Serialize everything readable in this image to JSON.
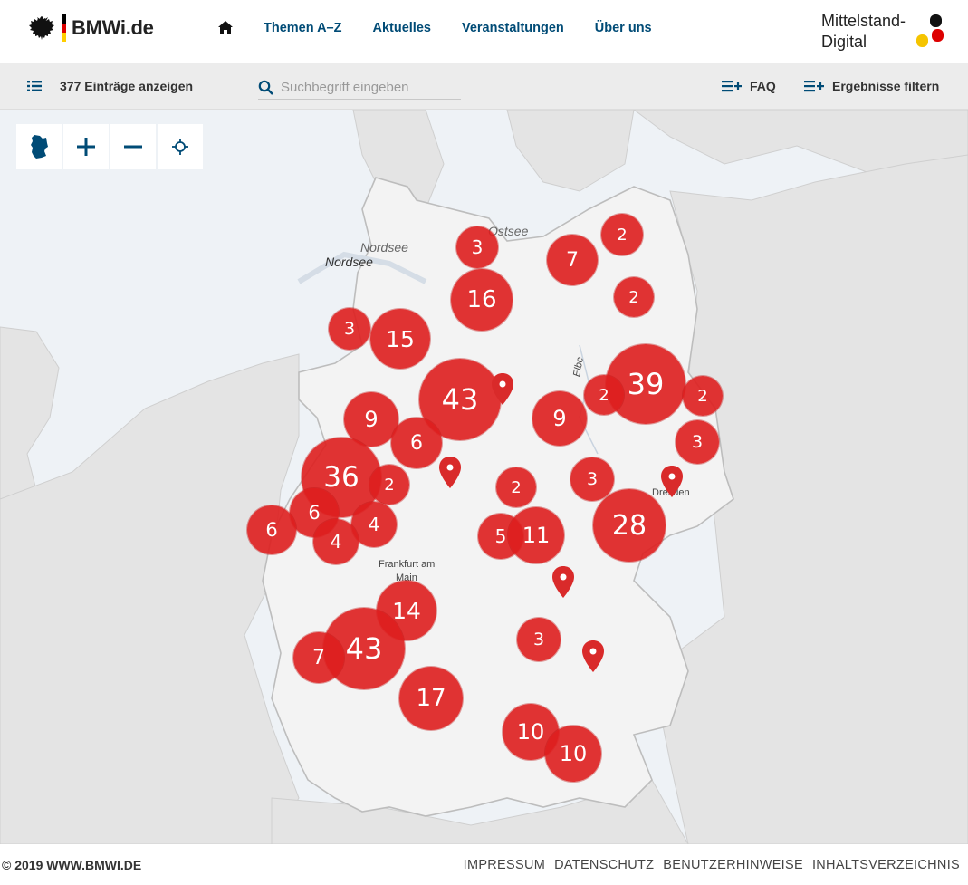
{
  "header": {
    "logo_text": "BMWi.de",
    "nav": [
      "Themen A–Z",
      "Aktuelles",
      "Veranstaltungen",
      "Über uns"
    ],
    "partner_line1": "Mittelstand-",
    "partner_line2": "Digital"
  },
  "toolbar": {
    "entries_label": "377 Einträge anzeigen",
    "search_placeholder": "Suchbegriff eingeben",
    "faq_label": "FAQ",
    "filter_label": "Ergebnisse filtern"
  },
  "map": {
    "labels": {
      "ostsee": "Ostsee",
      "nordsee1": "Nordsee",
      "nordsee2": "Nordsee",
      "frankfurt": "Frankfurt am",
      "main": "Main",
      "dresden": "Dresden",
      "elbe": "Elbe"
    },
    "clusters": [
      "3",
      "16",
      "7",
      "2",
      "2",
      "3",
      "15",
      "43",
      "39",
      "2",
      "2",
      "9",
      "9",
      "6",
      "3",
      "36",
      "2",
      "2",
      "3",
      "6",
      "6",
      "4",
      "4",
      "5",
      "11",
      "28",
      "14",
      "43",
      "7",
      "3",
      "17",
      "10",
      "10"
    ],
    "colors": {
      "cluster": "#de1e1e",
      "pin": "#d92a2a",
      "land": "#e4e4e4",
      "de_land": "#f2f2f2",
      "water": "#eef2f6"
    }
  },
  "footer": {
    "copyright": "© 2019 WWW.BMWI.DE",
    "links": [
      "IMPRESSUM",
      "DATENSCHUTZ",
      "BENUTZERHINWEISE",
      "INHALTSVERZEICHNIS"
    ]
  }
}
